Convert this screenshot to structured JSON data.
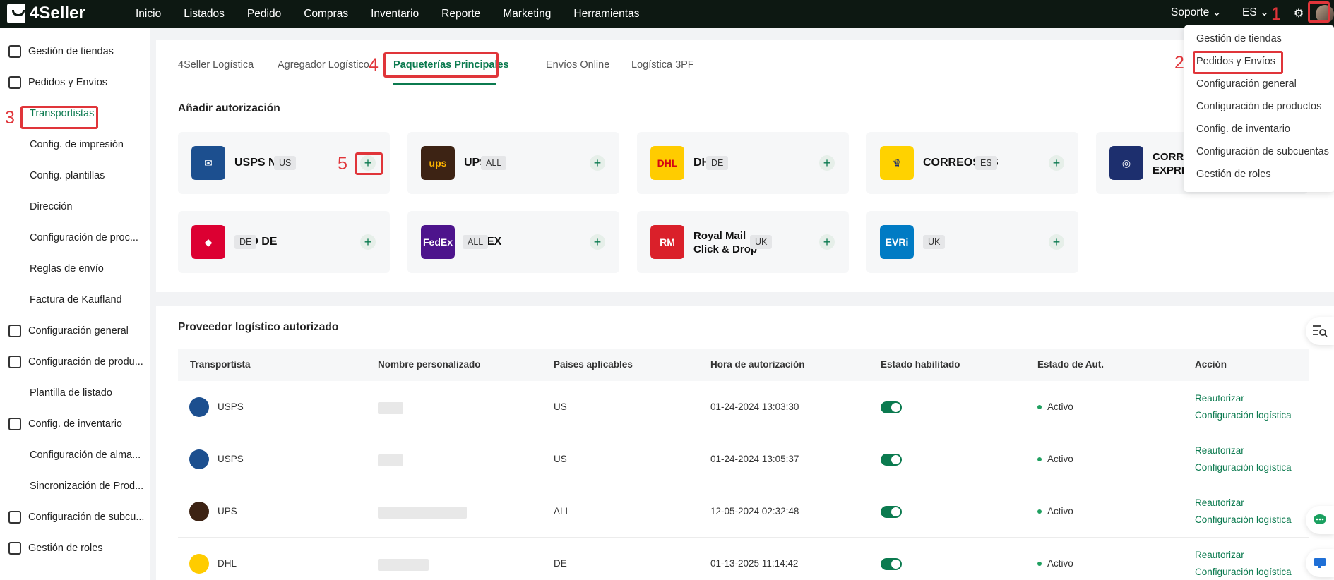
{
  "app": {
    "logo": "4Seller"
  },
  "nav": [
    "Inicio",
    "Listados",
    "Pedido",
    "Compras",
    "Inventario",
    "Reporte",
    "Marketing",
    "Herramientas"
  ],
  "topright": {
    "support": "Soporte",
    "lang": "ES"
  },
  "sidebar": [
    {
      "label": "Gestión de tiendas",
      "icon": "store-icon"
    },
    {
      "label": "Pedidos y Envíos",
      "icon": "orders-icon"
    },
    {
      "label": "Transportistas",
      "sub": true,
      "active": true
    },
    {
      "label": "Config. de impresión",
      "sub": true
    },
    {
      "label": "Config. plantillas",
      "sub": true
    },
    {
      "label": "Dirección",
      "sub": true
    },
    {
      "label": "Configuración de proc...",
      "sub": true
    },
    {
      "label": "Reglas de envío",
      "sub": true
    },
    {
      "label": "Factura de Kaufland",
      "sub": true
    },
    {
      "label": "Configuración general",
      "icon": "printer-icon"
    },
    {
      "label": "Configuración de produ...",
      "icon": "box-icon"
    },
    {
      "label": "Plantilla de listado",
      "sub": true
    },
    {
      "label": "Config. de inventario",
      "icon": "inventory-icon"
    },
    {
      "label": "Configuración de alma...",
      "sub": true
    },
    {
      "label": "Sincronización de Prod...",
      "sub": true
    },
    {
      "label": "Configuración de subcu...",
      "icon": "subaccount-icon"
    },
    {
      "label": "Gestión de roles",
      "icon": "user-icon"
    }
  ],
  "tabs": [
    "4Seller Logística",
    "Agregador Logístico",
    "Paqueterías Principales",
    "Envíos Online",
    "Logística 3PF"
  ],
  "add_auth_title": "Añadir autorización",
  "cards": [
    {
      "name": "USPS NEW",
      "tag": "US",
      "logo": "usps-logo",
      "color": "#1c4f8f"
    },
    {
      "name": "UPS",
      "tag": "ALL",
      "logo": "ups-logo",
      "color": "#3d2314"
    },
    {
      "name": "DHL",
      "tag": "DE",
      "logo": "dhl-logo",
      "color": "#ffcc00"
    },
    {
      "name": "CORREOS ES",
      "tag": "ES",
      "logo": "correos-logo",
      "color": "#ffd200"
    },
    {
      "name": "CORRE EXPRE",
      "tag": "",
      "logo": "correos-express-logo",
      "color": "#1d2f6e"
    },
    {
      "name": "DPD DE",
      "tag": "DE",
      "logo": "dpd-logo",
      "color": "#dc0032"
    },
    {
      "name": "FEDEX",
      "tag": "ALL",
      "logo": "fedex-logo",
      "color": "#4d148c"
    },
    {
      "name": "Royal Mail Click & Drop",
      "tag": "UK",
      "logo": "royal-mail-logo",
      "color": "#da202a"
    },
    {
      "name": "Evri",
      "tag": "UK",
      "logo": "evri-logo",
      "color": "#007bc4"
    }
  ],
  "provider_title": "Proveedor logístico autorizado",
  "table": {
    "headers": [
      "Transportista",
      "Nombre personalizado",
      "Países aplicables",
      "Hora de autorización",
      "Estado habilitado",
      "Estado de Aut.",
      "Acción"
    ],
    "rows": [
      {
        "carrier": "USPS",
        "country": "US",
        "time": "01-24-2024 13:03:30",
        "status": "Activo",
        "logo": "usps-logo"
      },
      {
        "carrier": "USPS",
        "country": "US",
        "time": "01-24-2024 13:05:37",
        "status": "Activo",
        "logo": "usps-logo"
      },
      {
        "carrier": "UPS",
        "country": "ALL",
        "time": "12-05-2024 02:32:48",
        "status": "Activo",
        "logo": "ups-logo"
      },
      {
        "carrier": "DHL",
        "country": "DE",
        "time": "01-13-2025 11:14:42",
        "status": "Activo",
        "logo": "dhl-logo"
      }
    ],
    "action1": "Reautorizar",
    "action2": "Configuración logística"
  },
  "dropdown": [
    "Gestión de tiendas",
    "Pedidos y Envíos",
    "Configuración general",
    "Configuración de productos",
    "Config. de inventario",
    "Configuración de subcuentas",
    "Gestión de roles"
  ],
  "annotations": [
    "1",
    "2",
    "3",
    "4",
    "5"
  ],
  "colors": {
    "accent": "#0b7a4f",
    "highlight": "#e0353a",
    "topbar": "#0d1812"
  }
}
